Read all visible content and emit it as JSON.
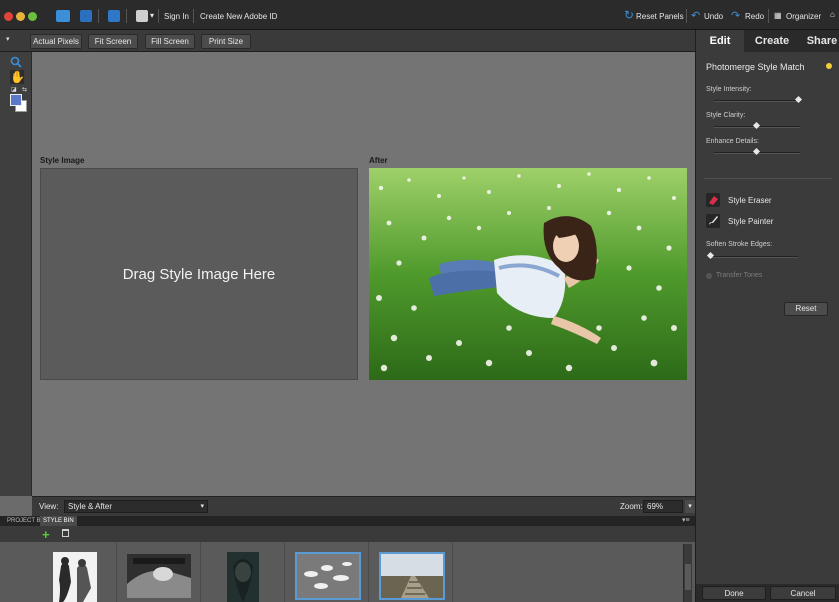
{
  "menubar": {
    "sign_in": "Sign In",
    "create_id": "Create New Adobe ID",
    "reset_panels": "Reset Panels",
    "undo": "Undo",
    "redo": "Redo",
    "organizer": "Organizer"
  },
  "toolbar": {
    "actual_pixels": "Actual Pixels",
    "fit_screen": "Fit Screen",
    "fill_screen": "Fill Screen",
    "print_size": "Print Size"
  },
  "canvas": {
    "style_image_label": "Style Image",
    "after_label": "After",
    "drop_text": "Drag Style Image Here"
  },
  "viewbar": {
    "view_label": "View:",
    "view_value": "Style & After",
    "zoom_label": "Zoom:",
    "zoom_value": "69%"
  },
  "bins": {
    "project_bin": "PROJECT BIN",
    "style_bin": "STYLE BIN"
  },
  "panel": {
    "tabs": [
      "Edit",
      "Create",
      "Share"
    ],
    "active_tab": "Edit",
    "title": "Photomerge Style Match",
    "style_intensity_label": "Style Intensity:",
    "style_intensity": 0.98,
    "style_clarity_label": "Style Clarity:",
    "style_clarity": 0.5,
    "enhance_details_label": "Enhance Details:",
    "enhance_details": 0.5,
    "style_eraser": "Style Eraser",
    "style_painter": "Style Painter",
    "soften_label": "Soften Stroke Edges:",
    "soften": 0.0,
    "transfer_tones": "Transfer Tones",
    "reset": "Reset",
    "done": "Done",
    "cancel": "Cancel"
  },
  "colors": {
    "accent_blue": "#3a8fd8",
    "selection_outline": "#5b9bd5",
    "eraser_red": "#d8304a"
  }
}
